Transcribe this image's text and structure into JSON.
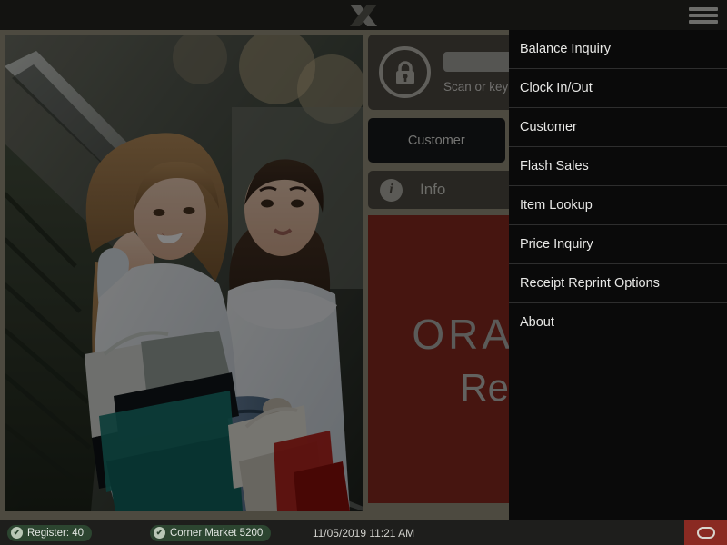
{
  "header": {
    "logo_icon": "xstore-x-logo",
    "menu_icon": "hamburger-menu-icon"
  },
  "login": {
    "lock_icon": "lock-icon",
    "input_value": "",
    "input_placeholder": "",
    "hint": "Scan or key your",
    "buttons": [
      {
        "label": "Customer",
        "name": "customer-button"
      },
      {
        "label": "",
        "name": "secondary-button"
      }
    ]
  },
  "info_row": {
    "icon": "info-icon",
    "label": "Info"
  },
  "brand": {
    "line1": "ORACLE",
    "line2": "Retail"
  },
  "menu": {
    "items": [
      {
        "label": "Balance Inquiry",
        "name": "menu-item-balance-inquiry"
      },
      {
        "label": "Clock In/Out",
        "name": "menu-item-clock-in-out"
      },
      {
        "label": "Customer",
        "name": "menu-item-customer"
      },
      {
        "label": "Flash Sales",
        "name": "menu-item-flash-sales"
      },
      {
        "label": "Item Lookup",
        "name": "menu-item-item-lookup"
      },
      {
        "label": "Price Inquiry",
        "name": "menu-item-price-inquiry"
      },
      {
        "label": "Receipt Reprint Options",
        "name": "menu-item-receipt-reprint-options"
      },
      {
        "label": "About",
        "name": "menu-item-about"
      }
    ]
  },
  "statusbar": {
    "register_badge": "Register: 40",
    "store_badge": "Corner Market 5200",
    "check_glyph": "✔",
    "timestamp": "11/05/2019 11:21 AM",
    "power_button_icon": "oval-indicator-icon"
  },
  "colors": {
    "menu_background": "#0a0a0a",
    "brand_red": "#82281f",
    "badge_green": "#2c4530",
    "status_red": "#8a2a22",
    "panel_tan": "#8e8a76"
  }
}
